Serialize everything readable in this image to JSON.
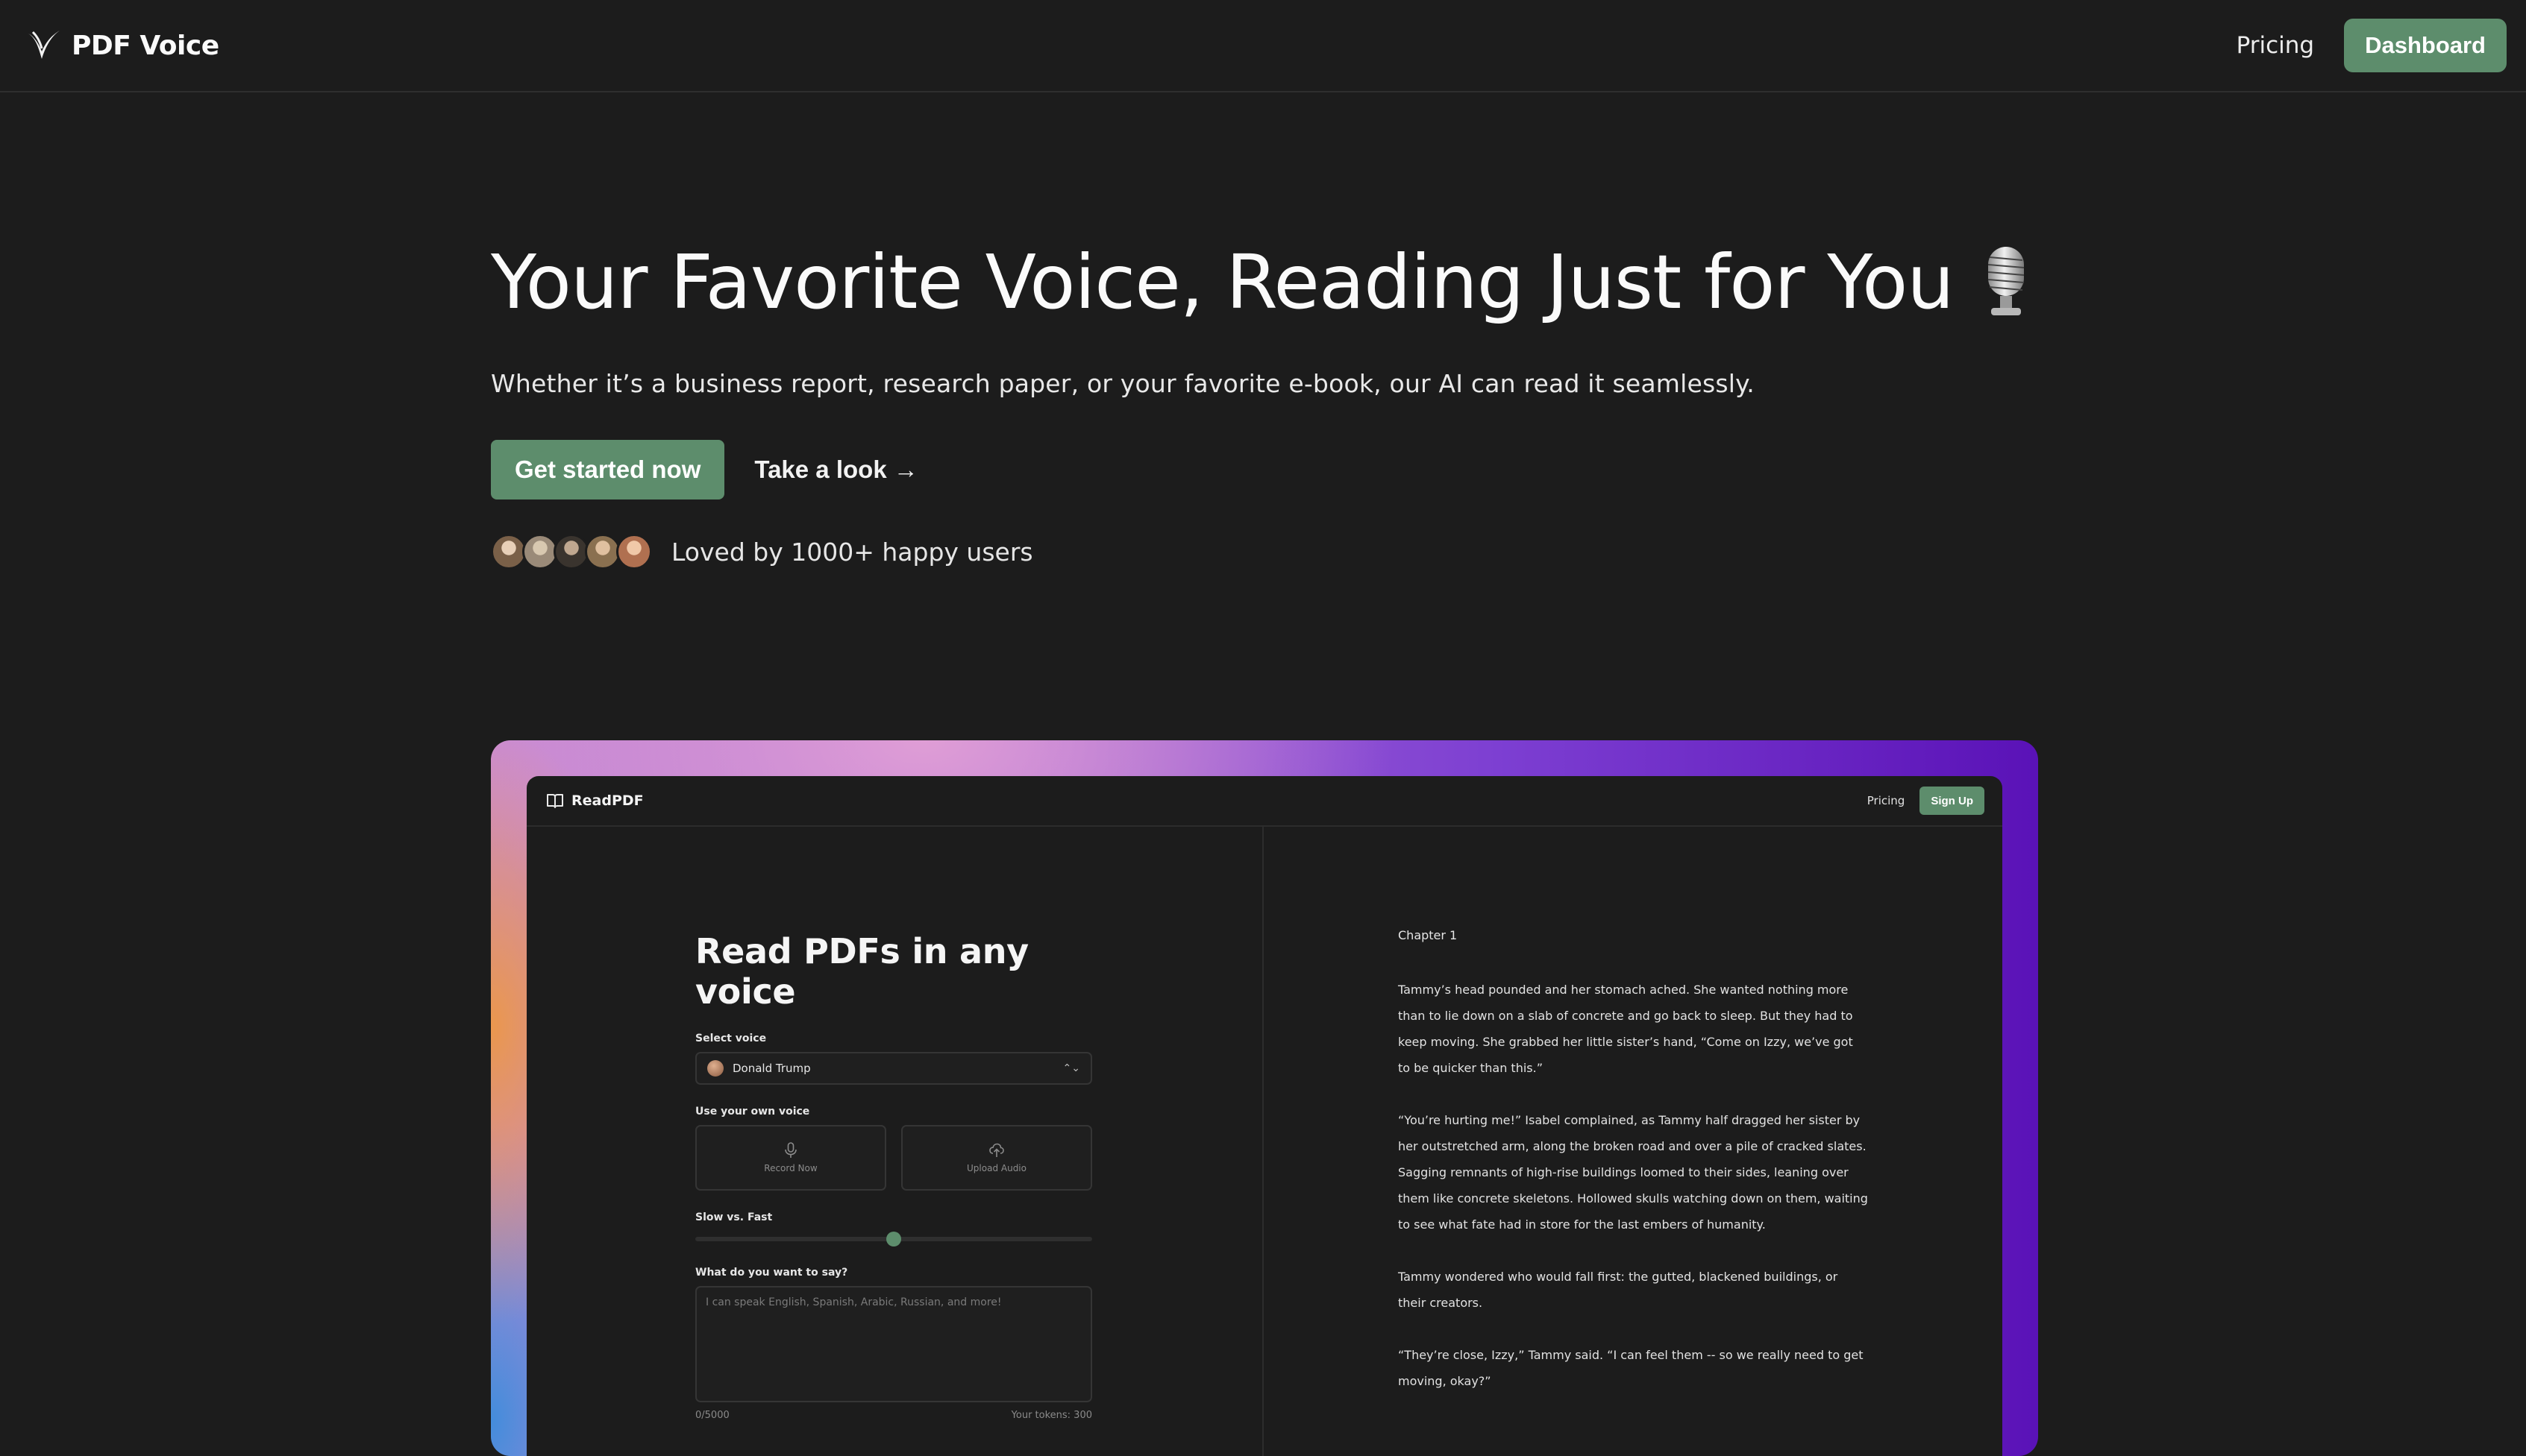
{
  "nav": {
    "brand": "PDF Voice",
    "pricing": "Pricing",
    "dashboard": "Dashboard"
  },
  "hero": {
    "title": "Your Favorite Voice, Reading Just for You",
    "title_icon": "microphone-icon",
    "subtitle": "Whether it’s a business report, research paper, or your favorite e-book, our AI can read it seamlessly.",
    "cta_primary": "Get started now",
    "cta_secondary": "Take a look →",
    "social_proof": "Loved by 1000+ happy users"
  },
  "preview": {
    "brand": "ReadPDF",
    "pricing": "Pricing",
    "signup": "Sign Up",
    "heading": "Read PDFs in any voice",
    "select_voice_label": "Select voice",
    "selected_voice": "Donald Trump",
    "own_voice_label": "Use your own voice",
    "record_label": "Record Now",
    "upload_label": "Upload Audio",
    "speed_label": "Slow vs. Fast",
    "speed_value": 0.5,
    "say_label": "What do you want to say?",
    "say_placeholder": "I can speak English, Spanish, Arabic, Russian, and more!",
    "char_count": "0/5000",
    "tokens": "Your tokens: 300",
    "chapter": "Chapter 1",
    "paragraphs": [
      "Tammy’s head pounded and her stomach ached. She wanted nothing more than to lie down on a slab of concrete and go back to sleep. But they had to keep moving. She grabbed her little sister’s hand, “Come on Izzy, we’ve got to be quicker than this.”",
      "“You’re hurting me!” Isabel complained, as Tammy half dragged her sister by her outstretched arm, along the broken road and over a pile of cracked slates. Sagging remnants of high-rise buildings loomed to their sides, leaning over them like concrete skeletons. Hollowed skulls watching down on them, waiting to see what fate had in store for the last embers of humanity.",
      "Tammy wondered who would fall first: the gutted, blackened buildings, or their creators.",
      "“They’re close, Izzy,” Tammy said. “I can feel them -- so we really need to get moving, okay?”"
    ]
  },
  "colors": {
    "accent": "#5d8d6c",
    "background": "#1c1c1c"
  }
}
